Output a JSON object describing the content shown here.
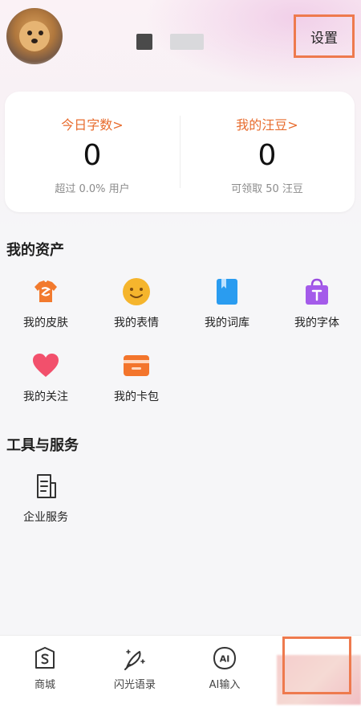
{
  "header": {
    "settings_label": "设置"
  },
  "stats": {
    "left": {
      "label": "今日字数>",
      "value": "0",
      "sub": "超过 0.0% 用户"
    },
    "right": {
      "label": "我的汪豆>",
      "value": "0",
      "sub": "可领取 50 汪豆"
    }
  },
  "assets": {
    "title": "我的资产",
    "items": [
      {
        "label": "我的皮肤",
        "icon": "shirt-icon"
      },
      {
        "label": "我的表情",
        "icon": "smiley-icon"
      },
      {
        "label": "我的词库",
        "icon": "book-icon"
      },
      {
        "label": "我的字体",
        "icon": "bag-icon"
      },
      {
        "label": "我的关注",
        "icon": "heart-icon"
      },
      {
        "label": "我的卡包",
        "icon": "wallet-icon"
      }
    ]
  },
  "tools": {
    "title": "工具与服务",
    "items": [
      {
        "label": "企业服务",
        "icon": "document-icon"
      }
    ]
  },
  "tabbar": {
    "items": [
      {
        "label": "商城",
        "icon": "shop-icon"
      },
      {
        "label": "闪光语录",
        "icon": "quill-icon"
      },
      {
        "label": "AI输入",
        "icon": "ai-icon"
      },
      {
        "label": "",
        "icon": "profile-icon"
      }
    ]
  },
  "colors": {
    "accent": "#e86c2e",
    "highlight_border": "#ee7a4e"
  }
}
